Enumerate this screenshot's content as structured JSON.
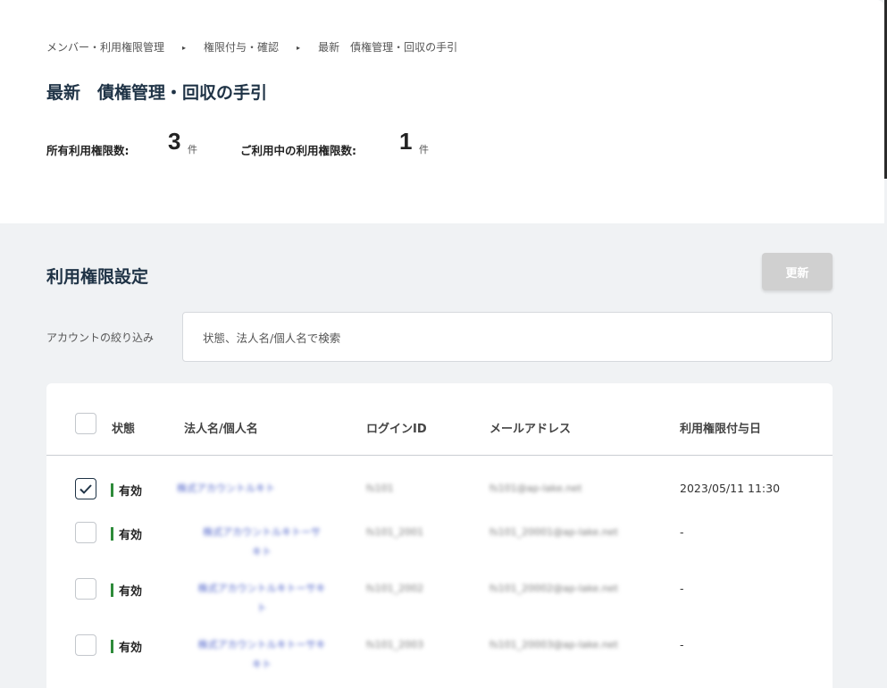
{
  "breadcrumb": [
    "メンバー・利用権限管理",
    "権限付与・確認",
    "最新　債権管理・回収の手引"
  ],
  "breadcrumb_separator": "▸",
  "page_title": "最新　債権管理・回収の手引",
  "counts": {
    "owned_label": "所有利用権限数:",
    "owned_value": "3",
    "inuse_label": "ご利用中の利用権限数:",
    "inuse_value": "1",
    "unit": "件"
  },
  "section_title": "利用権限設定",
  "update_button": "更新",
  "filter": {
    "label": "アカウントの絞り込み",
    "placeholder": "状態、法人名/個人名で検索"
  },
  "table": {
    "columns": [
      "状態",
      "法人名/個人名",
      "ログインID",
      "メールアドレス",
      "利用権限付与日"
    ],
    "rows": [
      {
        "checked": true,
        "status": "有効",
        "name": "株式アカウントルキト",
        "login_id": "fs101",
        "email": "fs101@ap-lake.net",
        "granted": "2023/05/11 11:30"
      },
      {
        "checked": false,
        "status": "有効",
        "name": "株式アカウントルキトーサ\nキト",
        "login_id": "fs101_2001",
        "email": "fs101_20001@ap-lake.net",
        "granted": "-"
      },
      {
        "checked": false,
        "status": "有効",
        "name": "株式アカウントルキトーサキ\nト",
        "login_id": "fs101_2002",
        "email": "fs101_20002@ap-lake.net",
        "granted": "-"
      },
      {
        "checked": false,
        "status": "有効",
        "name": "株式アカウントルキトーサキ\nキト",
        "login_id": "fs101_2003",
        "email": "fs101_20003@ap-lake.net",
        "granted": "-"
      }
    ]
  },
  "colors": {
    "accent": "#1f3346",
    "status_active": "#2e8b3a",
    "button_disabled": "#d0d0d0"
  }
}
